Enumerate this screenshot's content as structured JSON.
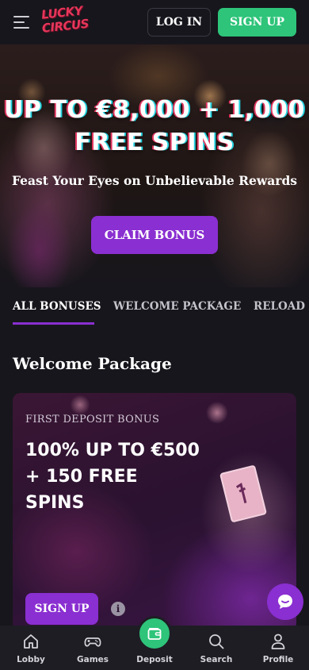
{
  "header": {
    "logo_line1": "LUCKY",
    "logo_line2": "CIRCUS",
    "login_label": "LOG IN",
    "signup_label": "SIGN UP"
  },
  "hero": {
    "title_line1": "UP TO €8,000 + 1,000",
    "title_line2": "FREE SPINS",
    "subtitle": "Feast Your Eyes on Unbelievable Rewards",
    "cta_label": "CLAIM BONUS"
  },
  "tabs": [
    {
      "label": "ALL BONUSES",
      "active": true
    },
    {
      "label": "WELCOME PACKAGE",
      "active": false
    },
    {
      "label": "RELOAD BONUS",
      "active": false
    }
  ],
  "section": {
    "title": "Welcome Package",
    "card": {
      "tag": "FIRST DEPOSIT BONUS",
      "title_line1": "100% UP TO €500",
      "title_line2": "+ 150 FREE SPINS",
      "signup_label": "SIGN UP",
      "info_glyph": "i"
    }
  },
  "bottom_nav": [
    {
      "label": "Lobby",
      "icon": "home-icon"
    },
    {
      "label": "Games",
      "icon": "gamepad-icon"
    },
    {
      "label": "Deposit",
      "icon": "wallet-icon"
    },
    {
      "label": "Search",
      "icon": "search-icon"
    },
    {
      "label": "Profile",
      "icon": "user-icon"
    }
  ],
  "colors": {
    "background": "#17161c",
    "accent_purple": "#8a2fd1",
    "accent_green": "#2ec47a",
    "logo_red": "#e7365a"
  }
}
